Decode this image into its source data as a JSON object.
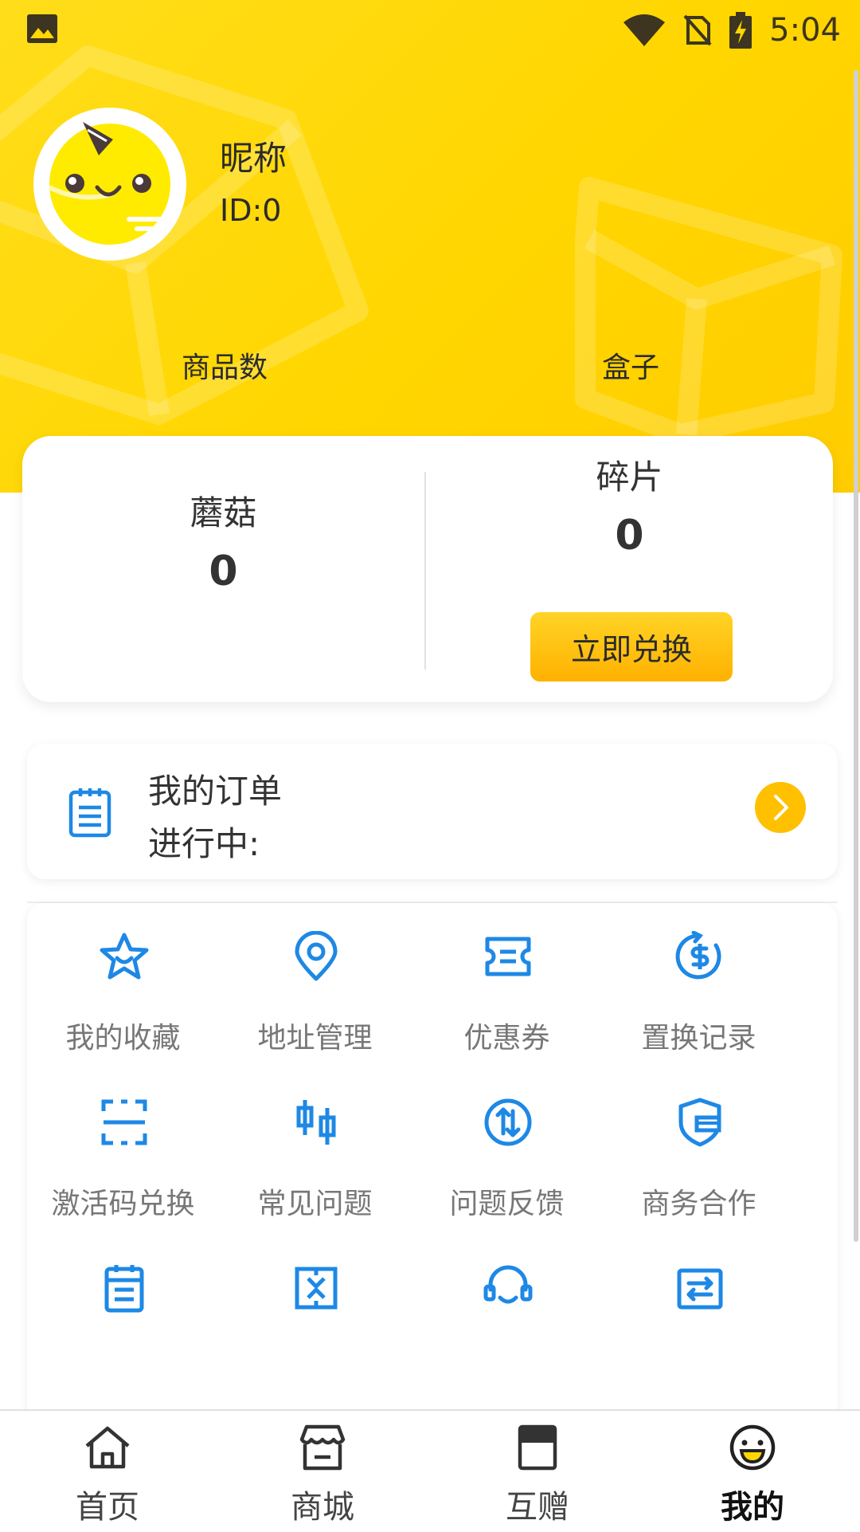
{
  "statusbar": {
    "time": "5:04"
  },
  "profile": {
    "nickname": "昵称",
    "id_text": "ID:0"
  },
  "stats": {
    "products_label": "商品数",
    "boxes_label": "盒子"
  },
  "wallet": {
    "mushroom_label": "蘑菇",
    "mushroom_value": "0",
    "fragment_label": "碎片",
    "fragment_value": "0",
    "redeem_button": "立即兑换"
  },
  "orders": {
    "title": "我的订单",
    "status": "进行中:"
  },
  "grid": {
    "items": [
      {
        "label": "我的收藏",
        "icon": "star-icon"
      },
      {
        "label": "地址管理",
        "icon": "location-pin-icon"
      },
      {
        "label": "优惠券",
        "icon": "ticket-icon"
      },
      {
        "label": "置换记录",
        "icon": "dollar-refresh-icon"
      },
      {
        "label": "激活码兑换",
        "icon": "scan-icon"
      },
      {
        "label": "常见问题",
        "icon": "candlestick-icon"
      },
      {
        "label": "问题反馈",
        "icon": "exchange-arrows-circle-icon"
      },
      {
        "label": "商务合作",
        "icon": "shield-card-icon"
      },
      {
        "label": "",
        "icon": "clipboard-icon"
      },
      {
        "label": "",
        "icon": "box-pattern-icon"
      },
      {
        "label": "",
        "icon": "headset-icon"
      },
      {
        "label": "",
        "icon": "swap-icon"
      }
    ]
  },
  "tabbar": {
    "tabs": [
      {
        "label": "首页",
        "icon": "home-icon"
      },
      {
        "label": "商城",
        "icon": "store-icon"
      },
      {
        "label": "互赠",
        "icon": "book-icon"
      },
      {
        "label": "我的",
        "icon": "smiley-icon"
      }
    ],
    "active": "我的"
  },
  "colors": {
    "header": "#ffd600",
    "accent": "#ffc000",
    "icon_blue": "#1e88e5"
  }
}
